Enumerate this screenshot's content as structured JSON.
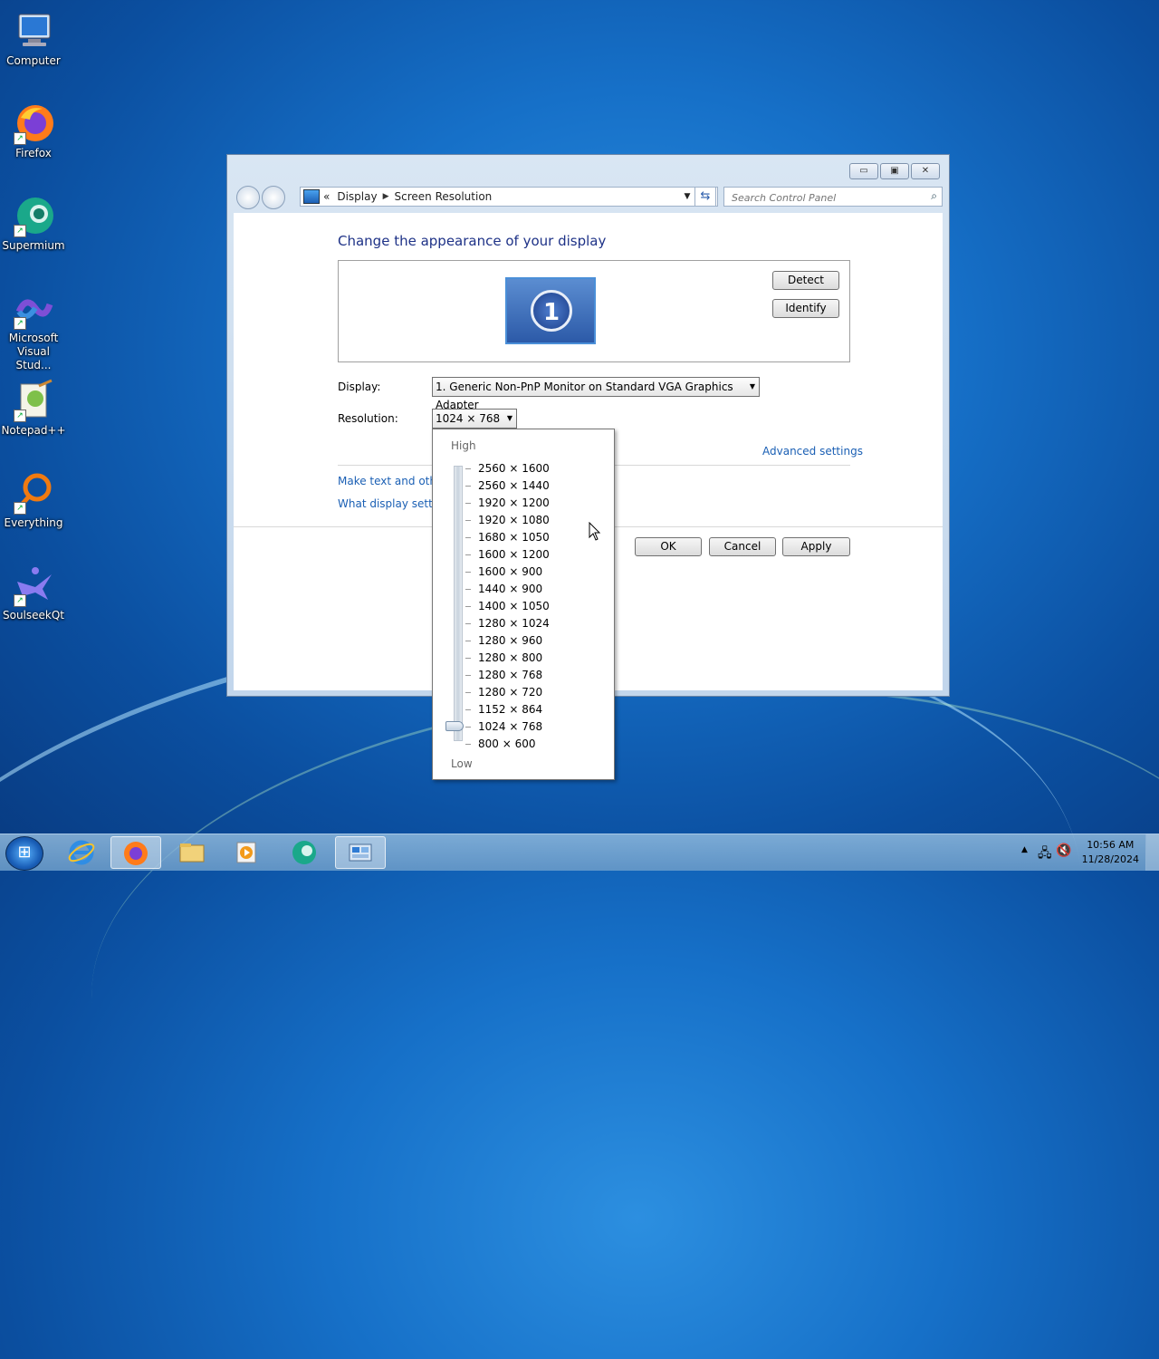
{
  "desktop": {
    "icons": [
      {
        "label": "Computer"
      },
      {
        "label": "Firefox"
      },
      {
        "label": "Supermium"
      },
      {
        "label": "Microsoft Visual Stud..."
      },
      {
        "label": "Notepad++"
      },
      {
        "label": "Everything"
      },
      {
        "label": "SoulseekQt"
      }
    ]
  },
  "window": {
    "breadcrumb": {
      "root_arrow": "«",
      "items": [
        "Display",
        "Screen Resolution"
      ]
    },
    "search_placeholder": "Search Control Panel",
    "caption": {
      "minimize": "▭",
      "maximize": "▣",
      "close": "✕"
    },
    "heading": "Change the appearance of your display",
    "monitor_number": "1",
    "detect_label": "Detect",
    "identify_label": "Identify",
    "display_label": "Display:",
    "display_value": "1. Generic Non-PnP Monitor on Standard VGA Graphics Adapter",
    "resolution_label": "Resolution:",
    "resolution_value": "1024 × 768",
    "advanced_link": "Advanced settings",
    "link_text_size": "Make text and other",
    "link_what_settings": "What display setting",
    "ok_label": "OK",
    "cancel_label": "Cancel",
    "apply_label": "Apply"
  },
  "resolution_dropdown": {
    "high_label": "High",
    "low_label": "Low",
    "options": [
      "2560 × 1600",
      "2560 × 1440",
      "1920 × 1200",
      "1920 × 1080",
      "1680 × 1050",
      "1600 × 1200",
      "1600 × 900",
      "1440 × 900",
      "1400 × 1050",
      "1280 × 1024",
      "1280 × 960",
      "1280 × 800",
      "1280 × 768",
      "1280 × 720",
      "1152 × 864",
      "1024 × 768",
      "800 × 600"
    ],
    "selected_index": 15
  },
  "taskbar": {
    "clock_time": "10:56 AM",
    "clock_date": "11/28/2024"
  },
  "colors": {
    "accent": "#1e3287",
    "link": "#1a5fb4"
  }
}
